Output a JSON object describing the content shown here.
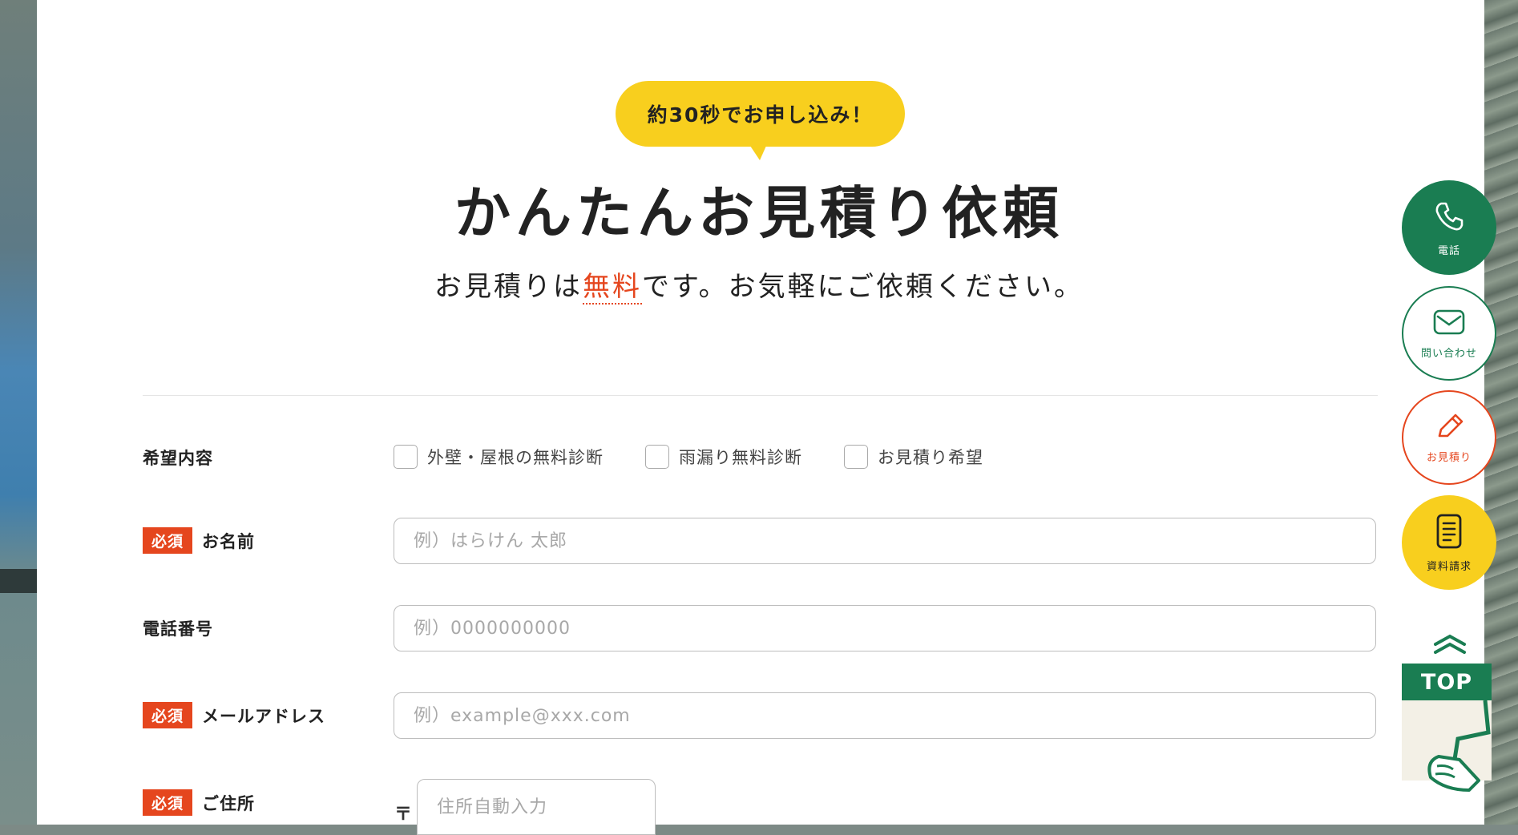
{
  "header": {
    "badge": "約30秒でお申し込み！",
    "title": "かんたんお見積り依頼",
    "subtitle_pre": "お見積りは",
    "subtitle_free": "無料",
    "subtitle_post": "です。お気軽にご依頼ください。"
  },
  "form": {
    "required_label": "必須",
    "request": {
      "label": "希望内容",
      "options": [
        "外壁・屋根の無料診断",
        "雨漏り無料診断",
        "お見積り希望"
      ]
    },
    "name": {
      "label": "お名前",
      "placeholder": "例）はらけん 太郎",
      "required": true
    },
    "phone": {
      "label": "電話番号",
      "placeholder": "例）0000000000",
      "required": false
    },
    "email": {
      "label": "メールアドレス",
      "placeholder": "例）example@xxx.com",
      "required": true
    },
    "address": {
      "label": "ご住所",
      "zip_mark": "〒",
      "placeholder": "住所自動入力",
      "required": true
    }
  },
  "side_nav": {
    "phone": {
      "label": "電話",
      "icon": "phone-icon"
    },
    "contact": {
      "label": "問い合わせ",
      "icon": "mail-icon"
    },
    "quote": {
      "label": "お見積り",
      "icon": "pencil-icon"
    },
    "documents": {
      "label": "資料請求",
      "icon": "document-icon"
    },
    "top": {
      "label": "TOP",
      "icon": "chevron-up-icon"
    }
  },
  "colors": {
    "accent_yellow": "#f8cf1e",
    "accent_green": "#1a7d52",
    "accent_red": "#e5461e"
  }
}
